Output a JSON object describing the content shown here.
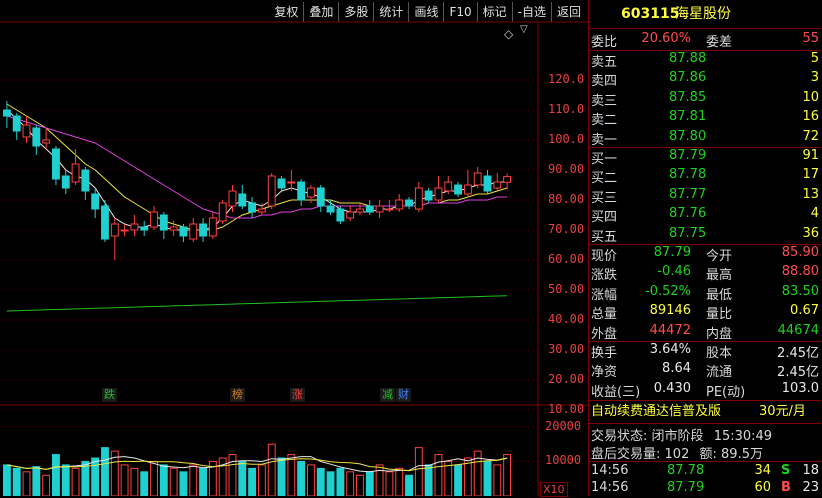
{
  "toolbar": [
    "复权",
    "叠加",
    "多股",
    "统计",
    "画线",
    "F10",
    "标记",
    "-自选",
    "返回"
  ],
  "diamond_icon": "◇",
  "price_axis": [
    "120.0",
    "110.0",
    "100.0",
    "90.00",
    "80.00",
    "70.00",
    "60.00",
    "50.00",
    "40.00",
    "30.00",
    "20.00",
    "10.00"
  ],
  "volume_axis": [
    "20000",
    "10000"
  ],
  "volume_unit": "X10",
  "events": [
    {
      "text": "跌",
      "color": "#20c020"
    },
    {
      "text": "榜",
      "color": "#d08020"
    },
    {
      "text": "涨",
      "color": "#ff4040"
    },
    {
      "text": "减",
      "color": "#20c020"
    },
    {
      "text": "财",
      "color": "#4080ff"
    }
  ],
  "stock": {
    "code": "603115",
    "name": "海星股份"
  },
  "order_ratio": {
    "label": "委比",
    "value": "20.60%",
    "diff_label": "委差",
    "diff_value": "55"
  },
  "asks": [
    {
      "label": "卖五",
      "price": "87.88",
      "vol": "5"
    },
    {
      "label": "卖四",
      "price": "87.86",
      "vol": "3"
    },
    {
      "label": "卖三",
      "price": "87.85",
      "vol": "10"
    },
    {
      "label": "卖二",
      "price": "87.81",
      "vol": "16"
    },
    {
      "label": "卖一",
      "price": "87.80",
      "vol": "72"
    }
  ],
  "bids": [
    {
      "label": "买一",
      "price": "87.79",
      "vol": "91"
    },
    {
      "label": "买二",
      "price": "87.78",
      "vol": "17"
    },
    {
      "label": "买三",
      "price": "87.77",
      "vol": "13"
    },
    {
      "label": "买四",
      "price": "87.76",
      "vol": "4"
    },
    {
      "label": "买五",
      "price": "87.75",
      "vol": "36"
    }
  ],
  "stats": [
    {
      "l1": "现价",
      "v1": "87.79",
      "c1": "green",
      "l2": "今开",
      "v2": "85.90",
      "c2": "red"
    },
    {
      "l1": "涨跌",
      "v1": "-0.46",
      "c1": "green",
      "l2": "最高",
      "v2": "88.80",
      "c2": "red"
    },
    {
      "l1": "涨幅",
      "v1": "-0.52%",
      "c1": "green",
      "l2": "最低",
      "v2": "83.50",
      "c2": "green"
    },
    {
      "l1": "总量",
      "v1": "89146",
      "c1": "yellow",
      "l2": "量比",
      "v2": "0.67",
      "c2": "yellow"
    },
    {
      "l1": "外盘",
      "v1": "44472",
      "c1": "red",
      "l2": "内盘",
      "v2": "44674",
      "c2": "green"
    }
  ],
  "fundamentals": [
    {
      "l1": "换手",
      "v1": "3.64%",
      "l2": "股本",
      "v2": "2.45亿"
    },
    {
      "l1": "净资",
      "v1": "8.64",
      "l2": "流通",
      "v2": "2.45亿"
    },
    {
      "l1": "收益(三)",
      "v1": "0.430",
      "l2": "PE(动)",
      "v2": "103.0"
    }
  ],
  "promo": {
    "text": "自动续费通达信普及版",
    "price": "30元/月"
  },
  "trade_status": {
    "label": "交易状态:",
    "value": "闭市阶段",
    "time": "15:30:49"
  },
  "after_hours": {
    "label": "盘后交易量:",
    "vol": "102",
    "amount_label": "额:",
    "amount": "89.5万"
  },
  "ticks": [
    {
      "time": "14:56",
      "price": "87.78",
      "vol": "34",
      "side": "S",
      "side_color": "#1fd21f",
      "num": "18"
    },
    {
      "time": "14:56",
      "price": "87.79",
      "vol": "60",
      "side": "B",
      "side_color": "#ff4d4d",
      "num": "23"
    }
  ],
  "chart_data": {
    "type": "candlestick",
    "ylim": [
      0,
      125
    ],
    "candles": [
      {
        "o": 110,
        "c": 108,
        "h": 113,
        "l": 104
      },
      {
        "o": 108,
        "c": 103,
        "h": 109,
        "l": 100
      },
      {
        "o": 101,
        "c": 105,
        "h": 108,
        "l": 99
      },
      {
        "o": 104,
        "c": 98,
        "h": 105,
        "l": 95
      },
      {
        "o": 99,
        "c": 100,
        "h": 104,
        "l": 97
      },
      {
        "o": 97,
        "c": 87,
        "h": 98,
        "l": 85
      },
      {
        "o": 88,
        "c": 84,
        "h": 90,
        "l": 82
      },
      {
        "o": 86,
        "c": 92,
        "h": 97,
        "l": 85
      },
      {
        "o": 90,
        "c": 83,
        "h": 91,
        "l": 80
      },
      {
        "o": 82,
        "c": 77,
        "h": 84,
        "l": 74
      },
      {
        "o": 78,
        "c": 67,
        "h": 80,
        "l": 66
      },
      {
        "o": 68,
        "c": 72,
        "h": 74,
        "l": 60
      },
      {
        "o": 70,
        "c": 70,
        "h": 72,
        "l": 68
      },
      {
        "o": 70,
        "c": 72,
        "h": 75,
        "l": 68
      },
      {
        "o": 71,
        "c": 70,
        "h": 73,
        "l": 68
      },
      {
        "o": 71,
        "c": 76,
        "h": 78,
        "l": 70
      },
      {
        "o": 75,
        "c": 70,
        "h": 76,
        "l": 67
      },
      {
        "o": 70,
        "c": 71,
        "h": 73,
        "l": 68
      },
      {
        "o": 71,
        "c": 68,
        "h": 72,
        "l": 66
      },
      {
        "o": 67,
        "c": 72,
        "h": 74,
        "l": 66
      },
      {
        "o": 72,
        "c": 68,
        "h": 74,
        "l": 66
      },
      {
        "o": 68,
        "c": 74,
        "h": 76,
        "l": 67
      },
      {
        "o": 73,
        "c": 79,
        "h": 80,
        "l": 72
      },
      {
        "o": 78,
        "c": 83,
        "h": 85,
        "l": 76
      },
      {
        "o": 82,
        "c": 78,
        "h": 85,
        "l": 77
      },
      {
        "o": 79,
        "c": 76,
        "h": 81,
        "l": 74
      },
      {
        "o": 76,
        "c": 77,
        "h": 79,
        "l": 75
      },
      {
        "o": 78,
        "c": 88,
        "h": 89,
        "l": 77
      },
      {
        "o": 87,
        "c": 84,
        "h": 88,
        "l": 83
      },
      {
        "o": 86,
        "c": 86,
        "h": 90,
        "l": 83
      },
      {
        "o": 86,
        "c": 80,
        "h": 87,
        "l": 78
      },
      {
        "o": 81,
        "c": 84,
        "h": 85,
        "l": 79
      },
      {
        "o": 84,
        "c": 78,
        "h": 85,
        "l": 76
      },
      {
        "o": 78,
        "c": 76,
        "h": 80,
        "l": 75
      },
      {
        "o": 77,
        "c": 73,
        "h": 78,
        "l": 72
      },
      {
        "o": 74,
        "c": 76,
        "h": 78,
        "l": 73
      },
      {
        "o": 76,
        "c": 77,
        "h": 79,
        "l": 75
      },
      {
        "o": 78,
        "c": 76,
        "h": 80,
        "l": 75
      },
      {
        "o": 76,
        "c": 78,
        "h": 80,
        "l": 74
      },
      {
        "o": 77,
        "c": 77,
        "h": 80,
        "l": 76
      },
      {
        "o": 77,
        "c": 80,
        "h": 82,
        "l": 76
      },
      {
        "o": 80,
        "c": 78,
        "h": 81,
        "l": 77
      },
      {
        "o": 77,
        "c": 84,
        "h": 86,
        "l": 76
      },
      {
        "o": 83,
        "c": 80,
        "h": 84,
        "l": 79
      },
      {
        "o": 80,
        "c": 84,
        "h": 88,
        "l": 79
      },
      {
        "o": 83,
        "c": 86,
        "h": 88,
        "l": 82
      },
      {
        "o": 85,
        "c": 82,
        "h": 86,
        "l": 81
      },
      {
        "o": 82,
        "c": 85,
        "h": 90,
        "l": 81
      },
      {
        "o": 85,
        "c": 89,
        "h": 91,
        "l": 84
      },
      {
        "o": 88,
        "c": 83,
        "h": 90,
        "l": 82
      },
      {
        "o": 84,
        "c": 86,
        "h": 89,
        "l": 83
      },
      {
        "o": 85.9,
        "c": 87.79,
        "h": 88.8,
        "l": 83.5
      }
    ],
    "ma_series": [
      {
        "color": "#e8e8e8",
        "values": [
          110,
          107,
          104,
          100,
          97,
          94,
          90,
          88,
          87,
          84,
          79,
          74,
          72,
          71,
          71,
          72,
          71,
          70,
          70,
          70,
          70,
          71,
          74,
          78,
          80,
          79,
          78,
          80,
          83,
          84,
          83,
          82,
          81,
          79,
          77,
          76,
          76,
          76,
          77,
          77,
          78,
          78,
          80,
          81,
          82,
          83,
          83,
          84,
          85,
          85,
          86,
          86
        ]
      },
      {
        "color": "#e8e840",
        "values": [
          112,
          110,
          108,
          106,
          104,
          101,
          98,
          95,
          92,
          90,
          87,
          84,
          81,
          79,
          77,
          75,
          73,
          72,
          71,
          70,
          70,
          70,
          71,
          73,
          75,
          76,
          77,
          78,
          79,
          80,
          80,
          80,
          80,
          80,
          79,
          79,
          79,
          78,
          78,
          78,
          78,
          78,
          78,
          79,
          79,
          80,
          80,
          81,
          82,
          82,
          83,
          84
        ]
      },
      {
        "color": "#e040e0",
        "values": [
          108,
          107,
          106,
          105,
          104,
          103,
          102,
          101,
          100,
          99,
          97,
          95,
          93,
          91,
          89,
          87,
          85,
          83,
          81,
          79,
          77,
          76,
          75,
          74,
          74,
          74,
          75,
          75,
          76,
          76,
          77,
          77,
          78,
          78,
          78,
          78,
          78,
          78,
          78,
          78,
          78,
          78,
          78,
          79,
          79,
          79,
          79,
          80,
          80,
          80,
          81,
          81
        ]
      },
      {
        "color": "#20c020",
        "values": [
          43,
          43.1,
          43.2,
          43.3,
          43.4,
          43.5,
          43.6,
          43.7,
          43.8,
          43.9,
          44,
          44.1,
          44.2,
          44.3,
          44.4,
          44.5,
          44.6,
          44.7,
          44.8,
          44.9,
          45,
          45.1,
          45.2,
          45.3,
          45.4,
          45.5,
          45.6,
          45.7,
          45.8,
          45.9,
          46,
          46.1,
          46.2,
          46.3,
          46.4,
          46.5,
          46.6,
          46.7,
          46.8,
          46.9,
          47,
          47.1,
          47.2,
          47.3,
          47.4,
          47.5,
          47.6,
          47.7,
          47.8,
          47.9,
          48,
          48.1
        ]
      }
    ],
    "volumes": [
      9000,
      8000,
      7000,
      8500,
      6000,
      12000,
      9000,
      8000,
      10000,
      11000,
      14000,
      13000,
      9000,
      8000,
      7000,
      10000,
      9000,
      8000,
      7000,
      9000,
      8000,
      10000,
      11000,
      12000,
      10000,
      8000,
      9000,
      15000,
      11000,
      12000,
      10000,
      9000,
      8000,
      7000,
      8000,
      7000,
      6000,
      7000,
      9000,
      7000,
      8000,
      6000,
      14000,
      9000,
      12000,
      10000,
      9000,
      11000,
      13000,
      10000,
      9000,
      12000
    ],
    "vol_ylim": [
      0,
      22000
    ]
  }
}
